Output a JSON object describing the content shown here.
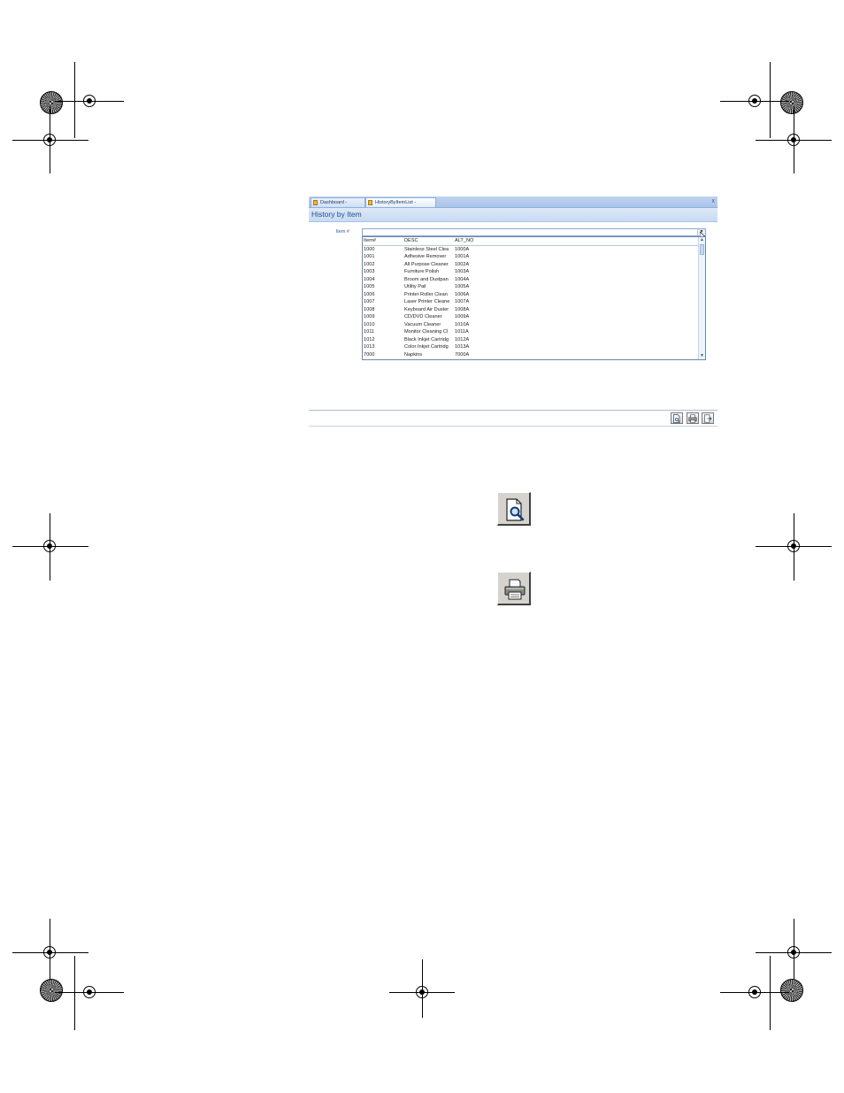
{
  "tabs": [
    {
      "label": "Dashboard - DEMO"
    },
    {
      "label": "HistoryByItemList - DEMO"
    }
  ],
  "tab_close_symbol": "x",
  "form": {
    "title": "History by Item",
    "item_label": "Item #",
    "item_value": ""
  },
  "dropdown": {
    "columns": [
      "Item#",
      "DESC",
      "ALT_NO"
    ],
    "rows": [
      [
        "1000",
        "Stainless Steel Clea",
        "1000A"
      ],
      [
        "1001",
        "Adhesive Remover",
        "1001A"
      ],
      [
        "1002",
        "All Purpose Cleaner",
        "1002A"
      ],
      [
        "1003",
        "Furniture Polish",
        "1003A"
      ],
      [
        "1004",
        "Broom and Dustpan",
        "1004A"
      ],
      [
        "1005",
        "Utility Pail",
        "1005A"
      ],
      [
        "1006",
        "Printer Roller Clean",
        "1006A"
      ],
      [
        "1007",
        "Laser Printer Cleane",
        "1007A"
      ],
      [
        "1008",
        "Keyboard Air Duster",
        "1008A"
      ],
      [
        "1009",
        "CD/DVD Cleaner",
        "1009A"
      ],
      [
        "1010",
        "Vacuum Cleaner",
        "1010A"
      ],
      [
        "1011",
        "Monitor Cleaning Cl",
        "1011A"
      ],
      [
        "1012",
        "Black Inkjet Cartridg",
        "1012A"
      ],
      [
        "1013",
        "Color Inkjet Cartridg",
        "1013A"
      ],
      [
        "7000",
        "Napkins",
        "7000A"
      ]
    ]
  },
  "toolbar": {
    "buttons": [
      "preview-icon",
      "print-icon",
      "exit-icon"
    ]
  },
  "enlarged_icons": [
    "preview-icon",
    "print-icon"
  ],
  "colors": {
    "tab_bar": "#bfd3ef",
    "form_header": "#dde8f7",
    "title_text": "#1f4f8f",
    "button_face": "#d6d3ce"
  }
}
